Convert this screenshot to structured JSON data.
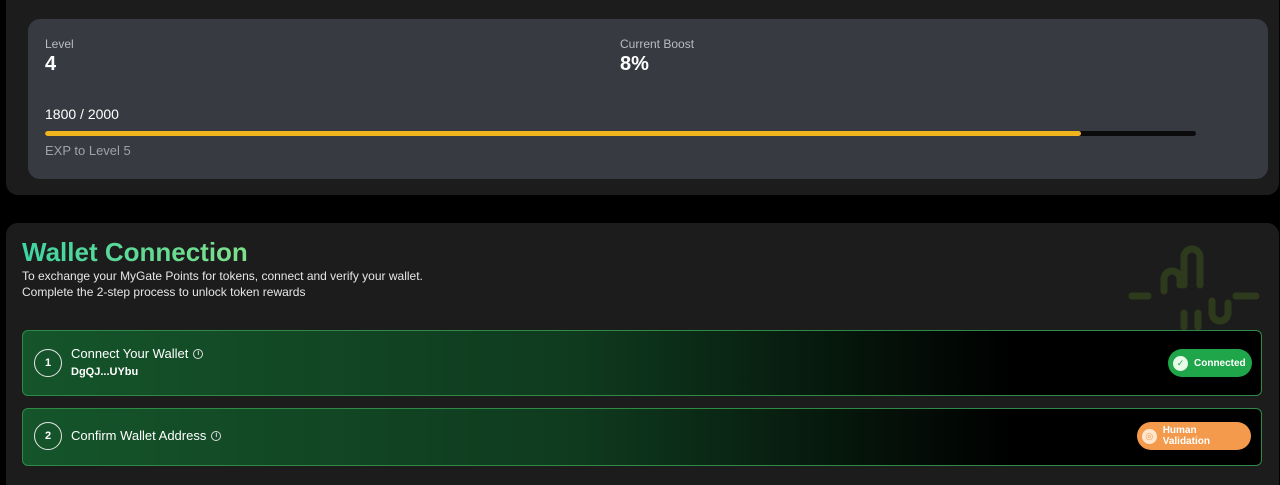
{
  "level": {
    "label": "Level",
    "value": "4",
    "boost_label": "Current Boost",
    "boost_value": "8%",
    "exp_progress": "1800 / 2000",
    "exp_caption": "EXP to Level 5",
    "progress_fraction": 0.9,
    "progress_color": "#f0b41f"
  },
  "wallet": {
    "title": "Wallet Connection",
    "description_line1": "To exchange your MyGate Points for tokens, connect and verify your wallet.",
    "description_line2": "Complete the 2-step process to unlock token rewards",
    "steps": [
      {
        "number": "1",
        "title": "Connect Your Wallet",
        "subtitle": "DgQJ...UYbu",
        "status": "Connected",
        "status_icon": "check-icon",
        "status_color": "#1fa64a"
      },
      {
        "number": "2",
        "title": "Confirm Wallet Address",
        "status": "Human Validation",
        "status_icon": "fingerprint-icon",
        "status_color": "#f39a4c"
      }
    ]
  }
}
